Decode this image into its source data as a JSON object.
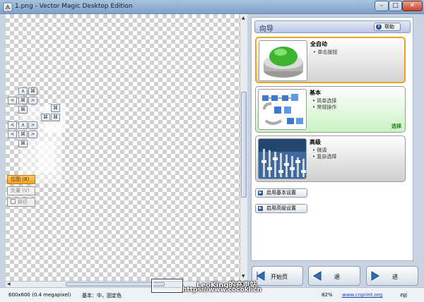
{
  "window": {
    "title": "1.png - Vector Magic Desktop Edition",
    "icon": "vector-magic-app-icon"
  },
  "window_controls": {
    "minimize": "–",
    "maximize": "□",
    "close": "✕"
  },
  "nav_controls": {
    "up": "∧",
    "left": "<",
    "right": ">",
    "fit": "⌘",
    "zoom_icons": [
      "zoom-fit-icon",
      "pan-up-icon",
      "pan-left-icon",
      "pan-right-icon"
    ]
  },
  "view_options": [
    {
      "label": "位图 (B)",
      "active": true
    },
    {
      "label": "矢量 (V)",
      "active": false
    },
    {
      "label": "路径",
      "active": false,
      "checkbox": true
    }
  ],
  "panel": {
    "title": "向导",
    "help_label": "帮助",
    "help_icon": "?",
    "cards": [
      {
        "title": "全自动",
        "lines": [
          "单击按钮"
        ],
        "tag": ""
      },
      {
        "title": "基本",
        "lines": [
          "简单选择",
          "常规操作"
        ],
        "tag": "选择"
      },
      {
        "title": "高级",
        "lines": [
          "微调",
          "复杂选择"
        ],
        "tag": ""
      }
    ],
    "option_buttons": [
      {
        "label": "启用基本设置"
      },
      {
        "label": "启用高级设置"
      }
    ]
  },
  "bottom_buttons": {
    "home": "开始页",
    "back": "退",
    "next": "进"
  },
  "status": {
    "dimensions": "600x600 (0.4 megapixel)",
    "mode": "基本：中，固定色",
    "zoom": "82%",
    "link": "www.cnprint.org",
    "suffix": "zgj"
  },
  "watermark": {
    "text": "LeoKing的充电站",
    "url": "https://www.cocokl.cn"
  },
  "colors": {
    "accent": "#e9a421",
    "link": "#1d3fb8",
    "green_card": "#c9f3c2"
  }
}
